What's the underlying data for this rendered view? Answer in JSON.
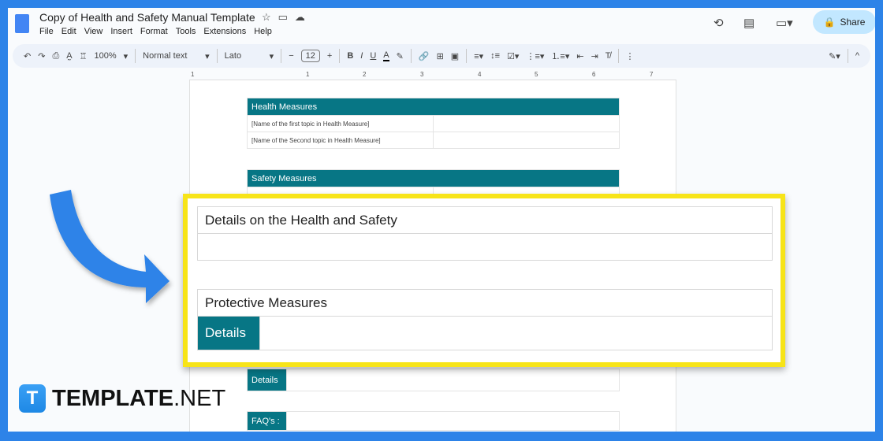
{
  "doc": {
    "title": "Copy of Health and Safety Manual Template",
    "menu": [
      "File",
      "Edit",
      "View",
      "Insert",
      "Format",
      "Tools",
      "Extensions",
      "Help"
    ]
  },
  "toolbar": {
    "zoom": "100%",
    "style": "Normal text",
    "font": "Lato",
    "size": "12"
  },
  "header": {
    "share": "Share"
  },
  "ruler": [
    "1",
    "1",
    "2",
    "3",
    "4",
    "5",
    "6",
    "7"
  ],
  "page": {
    "health": {
      "title": "Health Measures",
      "rows": [
        "[Name of the first topic in Health Measure]",
        "[Name of the Second topic in Health Measure]"
      ]
    },
    "safety": {
      "title": "Safety Measures"
    },
    "details": "Details",
    "faq": "FAQ's :"
  },
  "highlight": {
    "details_title": "Details on the Health and Safety",
    "protective": "Protective Measures",
    "details": "Details",
    "color": "#f7e418"
  },
  "logo": {
    "brand": "TEMPLATE",
    "suffix": ".NET"
  }
}
